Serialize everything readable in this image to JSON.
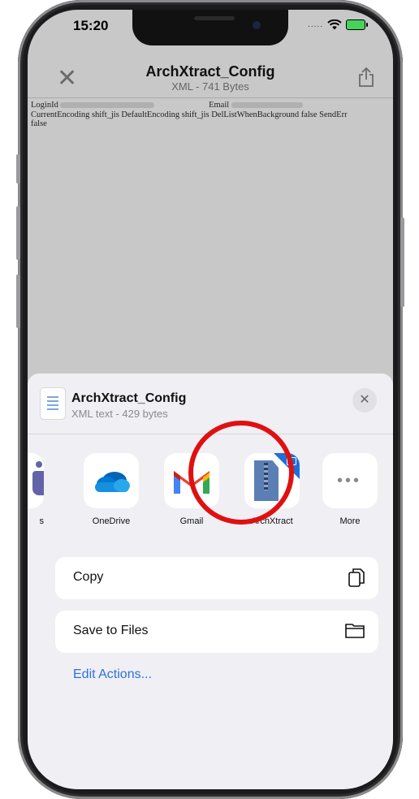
{
  "status": {
    "time": "15:20",
    "signal_dots": "....."
  },
  "nav": {
    "title": "ArchXtract_Config",
    "subtitle": "XML - 741 Bytes"
  },
  "xml": {
    "line1_a": "LoginId",
    "line1_b": "Email",
    "line2": "CurrentEncoding shift_jis DefaultEncoding shift_jis DelListWhenBackground false SendErr",
    "line3": "false"
  },
  "sheet": {
    "file_title": "ArchXtract_Config",
    "file_meta": "XML text - 429 bytes",
    "apps": [
      {
        "label": "s",
        "icon": "teams-icon"
      },
      {
        "label": "OneDrive",
        "icon": "onedrive-icon"
      },
      {
        "label": "Gmail",
        "icon": "gmail-icon"
      },
      {
        "label": "ArchXtract",
        "icon": "archxtract-icon"
      },
      {
        "label": "More",
        "icon": "more-icon"
      }
    ],
    "actions": [
      {
        "label": "Copy",
        "icon": "copy-icon"
      },
      {
        "label": "Save to Files",
        "icon": "folder-icon"
      }
    ],
    "edit_actions": "Edit Actions..."
  },
  "colors": {
    "highlight": "#e01010",
    "link": "#2d72d9"
  }
}
